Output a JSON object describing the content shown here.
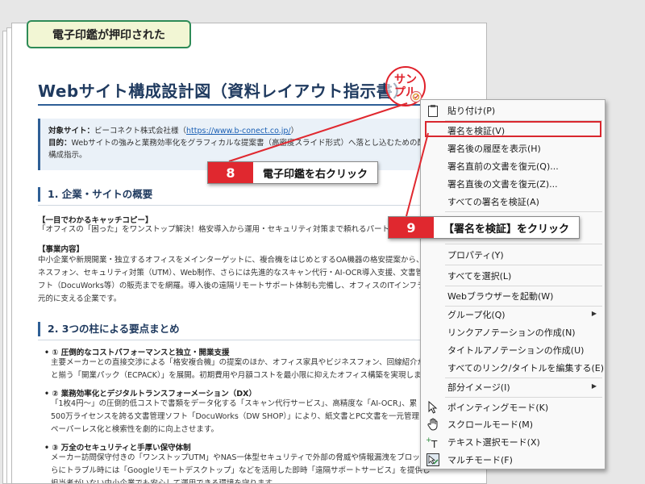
{
  "banner": "電子印鑑が押印された",
  "doc": {
    "title": "Webサイト構成設計図（資料レイアウト指示書）",
    "info_site_label": "対象サイト：",
    "info_site_text": "ビーコネクト株式会社様（",
    "info_site_link": "https://www.b-conect.co.jp/",
    "info_site_close": "）",
    "info_purpose_label": "目的：",
    "info_purpose_text": "Webサイトの強みと業務効率化をグラフィカルな提案書（高密度スライド形式）へ落とし込むための配置",
    "info_purpose_text2": "構成指示。",
    "sec1": "1. 企業・サイトの概要",
    "catch_label": "【一目でわかるキャッチコピー】",
    "catch_text": "「オフィスの「困った」をワンストップ解決！格安導入から運用・セキュリティ対策まで頼れるパート",
    "biz_label": "【事業内容】",
    "biz_line1": "中小企業や新規開業・独立するオフィスをメインターゲットに、複合機をはじめとするOA機器の格安提案から、",
    "biz_line2": "ネスフォン、セキュリティ対策（UTM）、Web制作、さらには先進的なスキャン代行・AI-OCR導入支援、文書管",
    "biz_line3": "フト（DocuWorks等）の販売までを網羅。導入後の遠隔リモートサポート体制も完備し、オフィスのITインフラを",
    "biz_line4": "元的に支える企業です。",
    "sec2": "2. 3つの柱による要点まとめ",
    "p1_head": "• ① 圧倒的なコストパフォーマンスと独立・開業支援",
    "p1_line1": "主要メーカーとの直接交渉による「格安複合機」の提案のほか、オフィス家具やビジネスフォン、回線紹介が",
    "p1_line2": "と揃う「開業パック（ECPACK）」を展開。初期費用や月額コストを最小限に抑えたオフィス構築を実現しま",
    "p2_head": "• ② 業務効率化とデジタルトランスフォーメーション（DX）",
    "p2_line1": "「1枚4円〜」の圧倒的低コストで書類をデータ化する「スキャン代行サービス」、高精度な「AI-OCR」、累",
    "p2_line2": "500万ライセンスを誇る文書管理ソフト「DocuWorks（DW SHOP）」により、紙文書とPC文書を一元管理し",
    "p2_line3": "ペーパーレス化と検索性を劇的に向上させます。",
    "p3_head": "• ③ 万全のセキュリティと手厚い保守体制",
    "p3_line1": "メーカー訪問保守付きの「ワンストップUTM」やNAS一体型セキュリティで外部の脅威や情報漏洩をブロック",
    "p3_line2": "らにトラブル時には「Googleリモートデスクトップ」などを活用した即時「遠隔サポートサービス」を提供し",
    "p3_line3": "担当者がいない中小企業でも安心して運用できる環境を守ります。"
  },
  "stamp": {
    "line1": "サン",
    "line2": "プル"
  },
  "menu": {
    "items": [
      {
        "label": "貼り付け(P)",
        "icon": "clipboard-icon"
      },
      {
        "label": "署名を検証(V)"
      },
      {
        "label": "署名後の履歴を表示(H)"
      },
      {
        "label": "署名直前の文書を復元(Q)..."
      },
      {
        "label": "署名直後の文書を復元(Z)..."
      },
      {
        "label": "すべての署名を検証(A)"
      },
      {
        "label": "プロパティ(Y)"
      },
      {
        "label": "すべてを選択(L)"
      },
      {
        "label": "Webブラウザーを起動(W)"
      },
      {
        "label": "グループ化(Q)",
        "submenu": true
      },
      {
        "label": "リンクアノテーションの作成(N)"
      },
      {
        "label": "タイトルアノテーションの作成(U)"
      },
      {
        "label": "すべてのリンク/タイトルを編集する(E)"
      },
      {
        "label": "部分イメージ(I)",
        "submenu": true
      },
      {
        "label": "ポインティングモード(K)",
        "icon": "pointer-icon"
      },
      {
        "label": "スクロールモード(M)",
        "icon": "hand-icon"
      },
      {
        "label": "テキスト選択モード(X)",
        "icon": "text-select-icon"
      },
      {
        "label": "マルチモード(F)",
        "icon": "multi-mode-icon"
      }
    ],
    "submenu_arrow": "▶"
  },
  "callouts": {
    "c8_num": "8",
    "c8_text": "電子印鑑を右クリック",
    "c9_num": "9",
    "c9_text": "【署名を検証】をクリック"
  },
  "colors": {
    "accent_red": "#e0282f",
    "heading_blue": "#1f3a5f",
    "banner_green": "#2e8b57"
  }
}
